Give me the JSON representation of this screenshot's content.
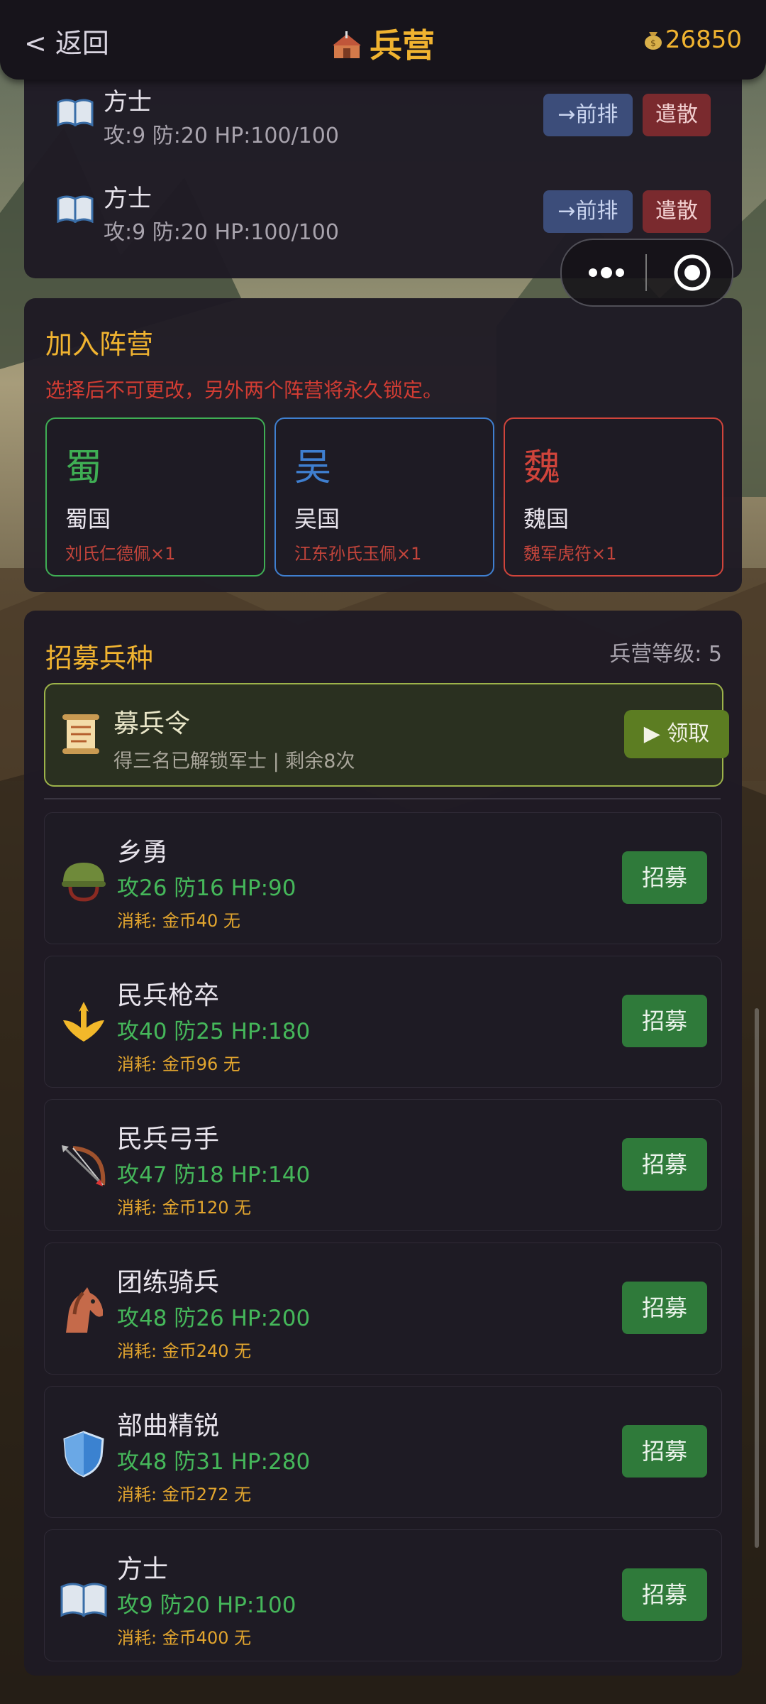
{
  "header": {
    "back_label": "< 返回",
    "title": "兵营",
    "title_icon": "barracks-icon",
    "gold": "26850",
    "gold_icon": "money-bag-icon"
  },
  "roster": [
    {
      "name": "方士",
      "stats": "攻:9 防:20  HP:100/100",
      "front_label": "→前排",
      "dismiss_label": "遣散",
      "icon": "book-icon"
    },
    {
      "name": "方士",
      "stats": "攻:9 防:20  HP:100/100",
      "front_label": "→前排",
      "dismiss_label": "遣散",
      "icon": "book-icon"
    }
  ],
  "faction": {
    "title": "加入阵营",
    "warning": "选择后不可更改，另外两个阵营将永久锁定。",
    "options": [
      {
        "glyph": "蜀",
        "name": "蜀国",
        "item": "刘氏仁德佩×1",
        "color": "#3fae54"
      },
      {
        "glyph": "吴",
        "name": "吴国",
        "item": "江东孙氏玉佩×1",
        "color": "#3f7fd0"
      },
      {
        "glyph": "魏",
        "name": "魏国",
        "item": "魏军虎符×1",
        "color": "#d0443b"
      }
    ]
  },
  "recruit": {
    "title": "招募兵种",
    "level_label": "兵营等级: 5",
    "order": {
      "name": "募兵令",
      "desc": "得三名已解锁军士 | 剩余8次",
      "claim_label": "▶ 领取",
      "icon": "scroll-icon"
    },
    "units": [
      {
        "name": "乡勇",
        "stats": "攻26 防16 HP:90",
        "cost": "消耗: 金币40  无",
        "button": "招募",
        "icon": "helmet-icon"
      },
      {
        "name": "民兵枪卒",
        "stats": "攻40 防25 HP:180",
        "cost": "消耗: 金币96  无",
        "button": "招募",
        "icon": "trident-icon"
      },
      {
        "name": "民兵弓手",
        "stats": "攻47 防18 HP:140",
        "cost": "消耗: 金币120  无",
        "button": "招募",
        "icon": "bow-arrow-icon"
      },
      {
        "name": "团练骑兵",
        "stats": "攻48 防26 HP:200",
        "cost": "消耗: 金币240  无",
        "button": "招募",
        "icon": "horse-icon"
      },
      {
        "name": "部曲精锐",
        "stats": "攻48 防31 HP:280",
        "cost": "消耗: 金币272  无",
        "button": "招募",
        "icon": "shield-icon"
      },
      {
        "name": "方士",
        "stats": "攻9 防20 HP:100",
        "cost": "消耗: 金币400  无",
        "button": "招募",
        "icon": "book-icon"
      }
    ]
  },
  "colors": {
    "accent": "#f0b330",
    "stat_green": "#45b75a",
    "cost_orange": "#e2a52e",
    "warning_red": "#d23c33"
  }
}
